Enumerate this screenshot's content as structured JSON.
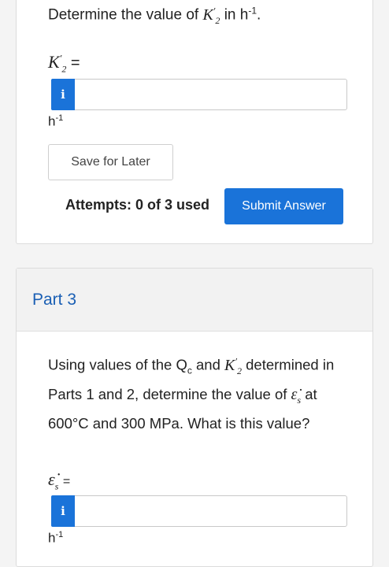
{
  "part2": {
    "question_prefix": "Determine the value of",
    "symbol_base": "K",
    "symbol_prime": "′",
    "symbol_sub": "2",
    "question_in": "in h",
    "question_exp": "-1",
    "question_end": ".",
    "equals": "=",
    "info_label": "i",
    "input_value": "",
    "unit_base": "h",
    "unit_exp": "-1",
    "save_label": "Save for Later",
    "attempts_text": "Attempts: 0 of 3 used",
    "submit_label": "Submit Answer"
  },
  "part3": {
    "title": "Part 3",
    "q_line1_a": "Using values of the Q",
    "q_qsub": "c",
    "q_line1_b": "and",
    "q_k_base": "K",
    "q_k_prime": "′",
    "q_k_sub": "2",
    "q_line1_c": "determined in Parts 1 and 2, determine the value of",
    "q_eps": "ε̇",
    "q_eps_sub": "s",
    "q_line2": "at 600°C and 300 MPa. What is this value?",
    "eq_eps": "ε̇",
    "eq_eps_sub": "s",
    "equals": "=",
    "info_label": "i",
    "input_value": "",
    "unit_base": "h",
    "unit_exp": "-1"
  },
  "colors": {
    "accent": "#1a73d9",
    "part_title": "#1a5fb4",
    "header_bg": "#f2f2f2"
  }
}
